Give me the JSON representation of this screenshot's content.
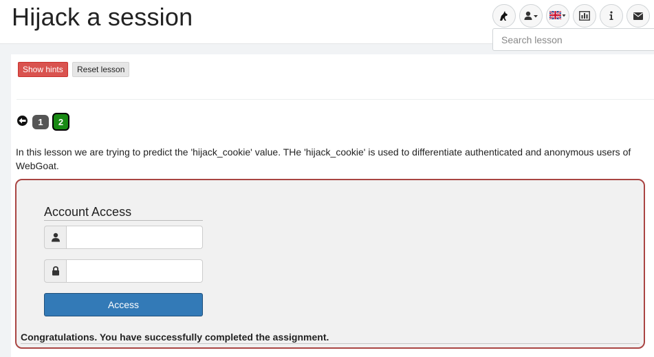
{
  "page": {
    "title": "Hijack a session"
  },
  "header": {
    "icons": [
      "webgoat-logo-icon",
      "user-icon",
      "language-flag-icon",
      "report-card-icon",
      "info-icon",
      "envelope-icon"
    ],
    "search_placeholder": "Search lesson"
  },
  "toolbar": {
    "show_hints_label": "Show hints",
    "reset_lesson_label": "Reset lesson"
  },
  "pagination": {
    "pages": [
      "1",
      "2"
    ],
    "current": "2"
  },
  "lesson": {
    "text": "In this lesson we are trying to predict the 'hijack_cookie' value. THe 'hijack_cookie' is used to differentiate authenticated and anonymous users of WebGoat."
  },
  "form": {
    "legend": "Account Access",
    "username_value": "",
    "password_value": "",
    "submit_label": "Access",
    "feedback": "Congratulations. You have successfully completed the assignment."
  },
  "colors": {
    "danger": "#d9534f",
    "primary": "#337ab7",
    "success": "#198a14",
    "form_border": "#a94442"
  }
}
